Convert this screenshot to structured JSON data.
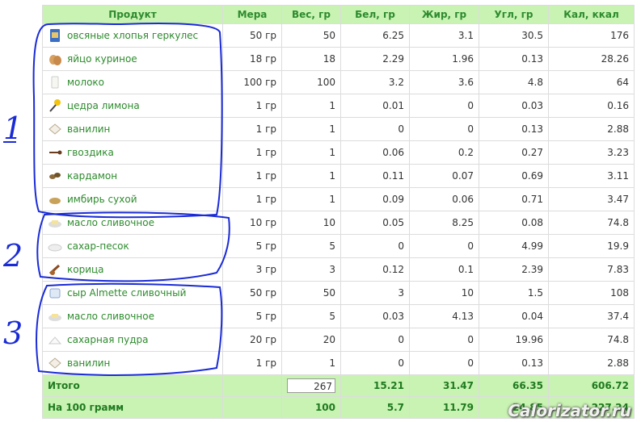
{
  "headers": {
    "product": "Продукт",
    "measure": "Мера",
    "weight": "Вес, гр",
    "protein": "Бел, гр",
    "fat": "Жир, гр",
    "carbs": "Угл, гр",
    "kcal": "Кал, ккал"
  },
  "rows": [
    {
      "icon": "oat-flakes-icon",
      "name": "овсяные хлопья геркулес",
      "measure": "50 гр",
      "weight": "50",
      "protein": "6.25",
      "fat": "3.1",
      "carbs": "30.5",
      "kcal": "176"
    },
    {
      "icon": "egg-icon",
      "name": "яйцо куриное",
      "measure": "18 гр",
      "weight": "18",
      "protein": "2.29",
      "fat": "1.96",
      "carbs": "0.13",
      "kcal": "28.26"
    },
    {
      "icon": "milk-glass-icon",
      "name": "молоко",
      "measure": "100 гр",
      "weight": "100",
      "protein": "3.2",
      "fat": "3.6",
      "carbs": "4.8",
      "kcal": "64"
    },
    {
      "icon": "lemon-zest-icon",
      "name": "цедра лимона",
      "measure": "1 гр",
      "weight": "1",
      "protein": "0.01",
      "fat": "0",
      "carbs": "0.03",
      "kcal": "0.16"
    },
    {
      "icon": "vanilla-icon",
      "name": "ванилин",
      "measure": "1 гр",
      "weight": "1",
      "protein": "0",
      "fat": "0",
      "carbs": "0.13",
      "kcal": "2.88"
    },
    {
      "icon": "clove-icon",
      "name": "гвоздика",
      "measure": "1 гр",
      "weight": "1",
      "protein": "0.06",
      "fat": "0.2",
      "carbs": "0.27",
      "kcal": "3.23"
    },
    {
      "icon": "cardamom-icon",
      "name": "кардамон",
      "measure": "1 гр",
      "weight": "1",
      "protein": "0.11",
      "fat": "0.07",
      "carbs": "0.69",
      "kcal": "3.11"
    },
    {
      "icon": "ginger-powder-icon",
      "name": "имбирь сухой",
      "measure": "1 гр",
      "weight": "1",
      "protein": "0.09",
      "fat": "0.06",
      "carbs": "0.71",
      "kcal": "3.47"
    },
    {
      "icon": "butter-icon",
      "name": "масло сливочное",
      "measure": "10 гр",
      "weight": "10",
      "protein": "0.05",
      "fat": "8.25",
      "carbs": "0.08",
      "kcal": "74.8"
    },
    {
      "icon": "sugar-icon",
      "name": "сахар-песок",
      "measure": "5 гр",
      "weight": "5",
      "protein": "0",
      "fat": "0",
      "carbs": "4.99",
      "kcal": "19.9"
    },
    {
      "icon": "cinnamon-icon",
      "name": "корица",
      "measure": "3 гр",
      "weight": "3",
      "protein": "0.12",
      "fat": "0.1",
      "carbs": "2.39",
      "kcal": "7.83"
    },
    {
      "icon": "cream-cheese-icon",
      "name": "сыр Almette сливочный",
      "measure": "50 гр",
      "weight": "50",
      "protein": "3",
      "fat": "10",
      "carbs": "1.5",
      "kcal": "108"
    },
    {
      "icon": "butter-icon",
      "name": "масло сливочное",
      "measure": "5 гр",
      "weight": "5",
      "protein": "0.03",
      "fat": "4.13",
      "carbs": "0.04",
      "kcal": "37.4"
    },
    {
      "icon": "powdered-sugar-icon",
      "name": "сахарная пудра",
      "measure": "20 гр",
      "weight": "20",
      "protein": "0",
      "fat": "0",
      "carbs": "19.96",
      "kcal": "74.8"
    },
    {
      "icon": "vanilla-icon",
      "name": "ванилин",
      "measure": "1 гр",
      "weight": "1",
      "protein": "0",
      "fat": "0",
      "carbs": "0.13",
      "kcal": "2.88"
    }
  ],
  "total": {
    "label": "Итого",
    "weight": "267",
    "protein": "15.21",
    "fat": "31.47",
    "carbs": "66.35",
    "kcal": "606.72"
  },
  "per100": {
    "label": "На 100 грамм",
    "weight": "100",
    "protein": "5.7",
    "fat": "11.79",
    "carbs": "24.85",
    "kcal": "227.24"
  },
  "annotations": [
    "1",
    "2",
    "3"
  ],
  "watermark": "Calorizator.ru",
  "colors": {
    "header_bg": "#c9f3b3",
    "green_text": "#2e8b2e",
    "annotation": "#1a2bd6"
  }
}
